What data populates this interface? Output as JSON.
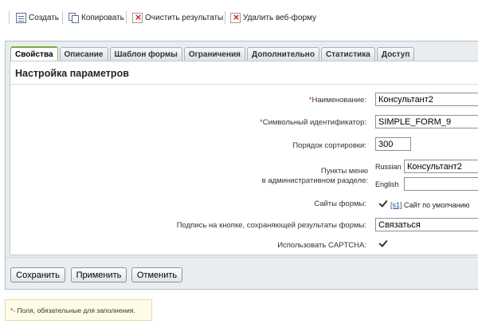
{
  "toolbar": {
    "create": "Создать",
    "copy": "Копировать",
    "clear_results": "Очистить результаты",
    "delete_form": "Удалить веб-форму"
  },
  "tabs": [
    {
      "label": "Свойства",
      "active": true
    },
    {
      "label": "Описание"
    },
    {
      "label": "Шаблон формы"
    },
    {
      "label": "Ограничения"
    },
    {
      "label": "Дополнительно"
    },
    {
      "label": "Статистика"
    },
    {
      "label": "Доступ"
    }
  ],
  "section_title": "Настройка параметров",
  "fields": {
    "name_label": "Наименование:",
    "name_value": "Консультант2",
    "code_label": "Символьный идентификатор:",
    "code_value": "SIMPLE_FORM_9",
    "sort_label": "Порядок сортировки:",
    "sort_value": "300",
    "menu_label_1": "Пункты меню",
    "menu_label_2": "в административном разделе:",
    "menu_lang_ru": "Russian",
    "menu_value_ru": "Консультант2",
    "menu_lang_en": "English",
    "menu_value_en": "",
    "sites_label": "Сайты формы:",
    "site_code": "[s1]",
    "site_name": "Сайт по умолчанию",
    "button_caption_label": "Подпись на кнопке, сохраняющей результаты формы:",
    "button_caption_value": "Связаться",
    "captcha_label": "Использовать CAPTCHA:"
  },
  "checkboxes": {
    "site_s1": true,
    "captcha": true
  },
  "buttons": {
    "save": "Сохранить",
    "apply": "Применить",
    "cancel": "Отменить"
  },
  "note": {
    "asterisk": "*",
    "text": " - Поля, обязательные для заполнения."
  },
  "colors": {
    "active_tab_accent": "#7cae3c",
    "required_marker": "#c81e1e",
    "link": "#1d4fa0",
    "panel_bg": "#e9edf0",
    "note_bg": "#fefbe6"
  }
}
